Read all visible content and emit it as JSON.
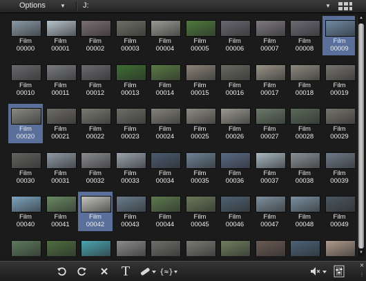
{
  "topbar": {
    "options_label": "Options",
    "path_label": "J:",
    "view_icon": "grid-view-icon"
  },
  "library": {
    "caption_prefix": "Film",
    "selected_indices": [
      9,
      20,
      42
    ],
    "items": [
      {
        "name": "Film",
        "number": "00000"
      },
      {
        "name": "Film",
        "number": "00001"
      },
      {
        "name": "Film",
        "number": "00002"
      },
      {
        "name": "Film",
        "number": "00003"
      },
      {
        "name": "Film",
        "number": "00004"
      },
      {
        "name": "Film",
        "number": "00005"
      },
      {
        "name": "Film",
        "number": "00006"
      },
      {
        "name": "Film",
        "number": "00007"
      },
      {
        "name": "Film",
        "number": "00008"
      },
      {
        "name": "Film",
        "number": "00009"
      },
      {
        "name": "Film",
        "number": "00010"
      },
      {
        "name": "Film",
        "number": "00011"
      },
      {
        "name": "Film",
        "number": "00012"
      },
      {
        "name": "Film",
        "number": "00013"
      },
      {
        "name": "Film",
        "number": "00014"
      },
      {
        "name": "Film",
        "number": "00015"
      },
      {
        "name": "Film",
        "number": "00016"
      },
      {
        "name": "Film",
        "number": "00017"
      },
      {
        "name": "Film",
        "number": "00018"
      },
      {
        "name": "Film",
        "number": "00019"
      },
      {
        "name": "Film",
        "number": "00020"
      },
      {
        "name": "Film",
        "number": "00021"
      },
      {
        "name": "Film",
        "number": "00022"
      },
      {
        "name": "Film",
        "number": "00023"
      },
      {
        "name": "Film",
        "number": "00024"
      },
      {
        "name": "Film",
        "number": "00025"
      },
      {
        "name": "Film",
        "number": "00026"
      },
      {
        "name": "Film",
        "number": "00027"
      },
      {
        "name": "Film",
        "number": "00028"
      },
      {
        "name": "Film",
        "number": "00029"
      },
      {
        "name": "Film",
        "number": "00030"
      },
      {
        "name": "Film",
        "number": "00031"
      },
      {
        "name": "Film",
        "number": "00032"
      },
      {
        "name": "Film",
        "number": "00033"
      },
      {
        "name": "Film",
        "number": "00034"
      },
      {
        "name": "Film",
        "number": "00035"
      },
      {
        "name": "Film",
        "number": "00036"
      },
      {
        "name": "Film",
        "number": "00037"
      },
      {
        "name": "Film",
        "number": "00038"
      },
      {
        "name": "Film",
        "number": "00039"
      },
      {
        "name": "Film",
        "number": "00040"
      },
      {
        "name": "Film",
        "number": "00041"
      },
      {
        "name": "Film",
        "number": "00042"
      },
      {
        "name": "Film",
        "number": "00043"
      },
      {
        "name": "Film",
        "number": "00044"
      },
      {
        "name": "Film",
        "number": "00045"
      },
      {
        "name": "Film",
        "number": "00046"
      },
      {
        "name": "Film",
        "number": "00047"
      },
      {
        "name": "Film",
        "number": "00048"
      },
      {
        "name": "Film",
        "number": "00049"
      },
      {
        "name": "",
        "number": ""
      },
      {
        "name": "",
        "number": ""
      },
      {
        "name": "",
        "number": ""
      },
      {
        "name": "",
        "number": ""
      },
      {
        "name": "",
        "number": ""
      },
      {
        "name": "",
        "number": ""
      },
      {
        "name": "",
        "number": ""
      },
      {
        "name": "",
        "number": ""
      },
      {
        "name": "",
        "number": ""
      },
      {
        "name": "",
        "number": ""
      }
    ],
    "thumb_colors": [
      "#8a9aa8",
      "#b7c3cc",
      "#7a6e74",
      "#6d7066",
      "#9a9a94",
      "#4e7a3c",
      "#6a6870",
      "#7e7a80",
      "#6c6a74",
      "#6d8aa6",
      "#6a6a6e",
      "#7a7c80",
      "#6a6a70",
      "#3e6e32",
      "#5a7a44",
      "#8a8478",
      "#6a6a62",
      "#9a9488",
      "#8e8a80",
      "#76746e",
      "#8a8a82",
      "#6e6c66",
      "#7a7a72",
      "#6e6e68",
      "#84827a",
      "#8e8c84",
      "#9a9890",
      "#6a7a6a",
      "#5a6a58",
      "#76746c",
      "#626260",
      "#8e9aa6",
      "#8a8c90",
      "#9aa4ae",
      "#4a5a6e",
      "#6e8296",
      "#5a6a86",
      "#a8b8c2",
      "#8a9298",
      "#6e7a88",
      "#7ca6c2",
      "#6a8a62",
      "#c2c4bc",
      "#6a7c8e",
      "#5e7a4e",
      "#6a7a58",
      "#4e6272",
      "#7e90a0",
      "#7a90a2",
      "#4a5660",
      "#5e7a5c",
      "#4e6e3e",
      "#4aa6b2",
      "#8a8c8a",
      "#6e6e6a",
      "#7a7a74",
      "#6e7e5e",
      "#6a5a52",
      "#4a6278",
      "#b09a8c"
    ]
  },
  "toolbar": {
    "undo_icon": "undo-icon",
    "redo_icon": "redo-icon",
    "delete_icon": "delete-x-icon",
    "title_icon": "title-text-icon",
    "transition_icon": "transition-icon",
    "fx_icon": "effects-icon",
    "audio_icon": "speaker-mute-icon",
    "mixer_icon": "mixer-icon"
  }
}
